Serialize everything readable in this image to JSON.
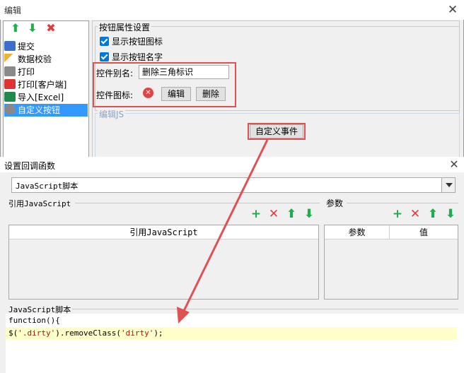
{
  "win1": {
    "title": "编辑"
  },
  "left_toolbar": {
    "icons": [
      "arrow-up-icon",
      "arrow-down-icon",
      "delete-icon"
    ]
  },
  "left_list": {
    "items": [
      {
        "label": "提交",
        "icon": "submit-icon"
      },
      {
        "label": "数据校验",
        "icon": "pencil-icon"
      },
      {
        "label": "打印",
        "icon": "printer-icon"
      },
      {
        "label": "打印[客户端]",
        "icon": "pdf-icon"
      },
      {
        "label": "导入[Excel]",
        "icon": "excel-icon"
      },
      {
        "label": "自定义按钮",
        "icon": "gear-icon",
        "selected": true
      }
    ]
  },
  "props": {
    "legend": "按钮属性设置",
    "show_icon_label": "显示按钮图标",
    "show_name_label": "显示按钮名字",
    "alias_label": "控件别名:",
    "alias_value": "删除三角标识",
    "icon_label": "控件图标:",
    "edit_button": "编辑",
    "delete_button": "删除"
  },
  "js_section": {
    "legend": "编辑JS",
    "custom_event_button": "自定义事件"
  },
  "win2": {
    "title": "设置回调函数",
    "select_value": "JavaScript脚本",
    "ref_group_label": "引用JavaScript",
    "ref_grid_header": "引用JavaScript",
    "params_group_label": "参数",
    "params_headers": [
      "参数",
      "值"
    ],
    "script_group_label": "JavaScript脚本",
    "code_line1": "function(){",
    "code_line2_prefix": "$(",
    "code_line2_str1": "'.dirty'",
    "code_line2_mid": ").removeClass(",
    "code_line2_str2": "'dirty'",
    "code_line2_suffix": ");"
  },
  "colors": {
    "accent": "#0078d7",
    "highlight_red": "#e05252",
    "selected_bg": "#3399ff",
    "green_icon": "#1fae4b",
    "red_icon": "#e23b3b",
    "code_highlight": "#ffffcc"
  }
}
